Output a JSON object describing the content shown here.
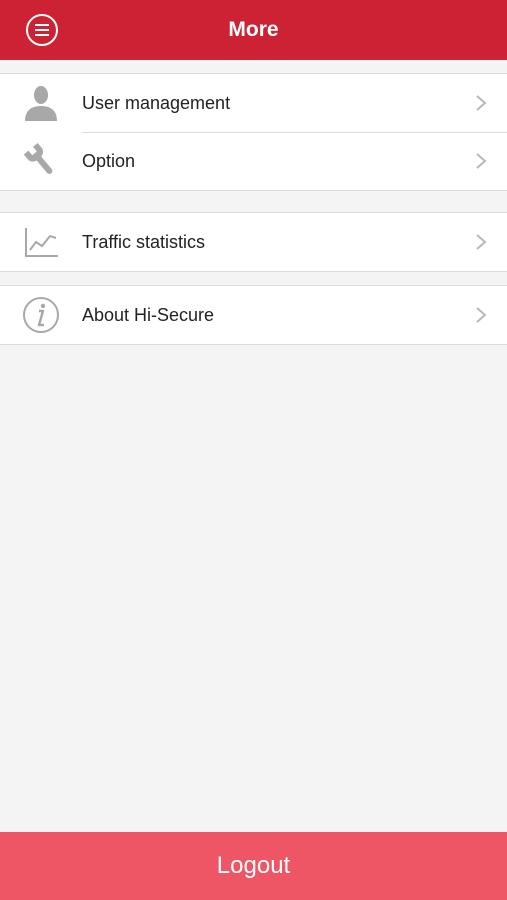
{
  "header": {
    "title": "More",
    "menu_icon": "menu-circle-icon",
    "background_color": "#cc2233"
  },
  "groups": [
    {
      "items": [
        {
          "label": "User management",
          "icon": "user-icon"
        },
        {
          "label": "Option",
          "icon": "wrench-icon"
        }
      ]
    },
    {
      "items": [
        {
          "label": "Traffic statistics",
          "icon": "line-chart-icon"
        }
      ]
    },
    {
      "items": [
        {
          "label": "About Hi-Secure",
          "icon": "info-icon"
        }
      ]
    }
  ],
  "logout": {
    "label": "Logout",
    "background_color": "#ee5565"
  }
}
